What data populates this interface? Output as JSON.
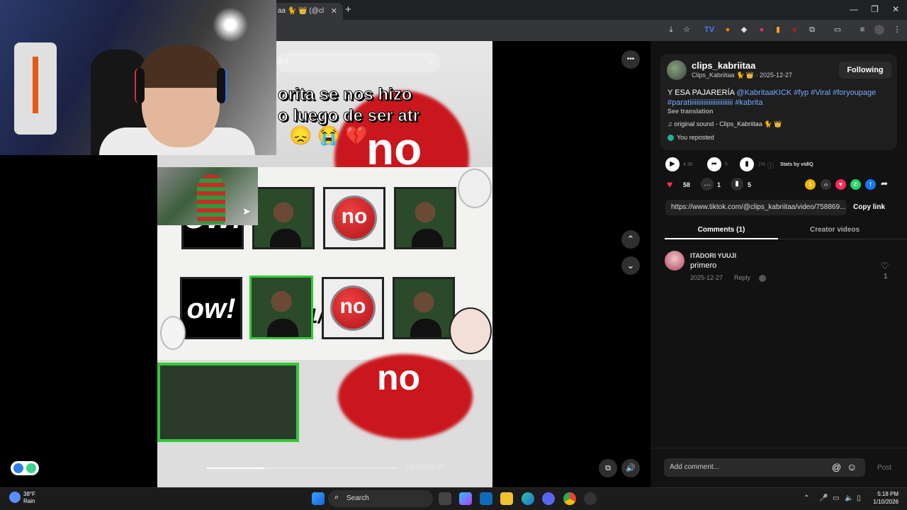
{
  "browser": {
    "tab_title": "aa 🐈 👑 (@cl",
    "tab_close": "✕",
    "new_tab": "+",
    "window_controls": [
      "—",
      "❐",
      "✕"
    ]
  },
  "video": {
    "overlay_line1": "orita se nos hizo",
    "overlay_line2": "o luego de ser atr",
    "overlay_emojis": "😞 😭 💔",
    "top_bg_text": "no",
    "grid_counter": "1/5",
    "row1": [
      "OW!",
      "face",
      "no",
      "face"
    ],
    "row2": [
      "ow!",
      "face",
      "no",
      "face"
    ],
    "bottom_bg_text": "no",
    "search_placeholder": "ent",
    "progress_fraction": 0.3,
    "time": "00:03/00:15"
  },
  "side_controls": {
    "more_icon": "•••",
    "up_icon": "⌃",
    "down_icon": "⌄"
  },
  "post": {
    "username": "clips_kabriitaa",
    "subline": "Clips_Kabriitaa 🐈 👑 · 2025-12-27",
    "follow_label": "Following",
    "desc_prefix": "Y ESA PAJARERÍA ",
    "desc_mention": "@KabritaaKICK",
    "desc_tags1": " #fyp #Viral #foryoupage",
    "desc_tags2": "#paratiiiiiiiiiiiiiiiiiiiiiiiii #kabrita",
    "see_translation": "See translation",
    "sound": "♫  original sound - Clips_Kabriitaa 🐈 👑",
    "reposted": "You reposted"
  },
  "stats": {
    "views": "4.3K",
    "shares_small": "5",
    "pct": "1%",
    "stats_by": "Stats by vidIQ",
    "likes": "58",
    "comments": "1",
    "saves": "5"
  },
  "share": {
    "url": "https://www.tiktok.com/@clips_kabriitaa/video/758869...",
    "copy_label": "Copy link"
  },
  "tabs": {
    "comments": "Comments (1)",
    "creator": "Creator videos"
  },
  "comment": {
    "user": "ITADORI YUUJI",
    "text": "primero",
    "date": "2025-12-27",
    "reply": "Reply",
    "likes": "1"
  },
  "compose": {
    "placeholder": "Add comment...",
    "at": "@",
    "emoji": "☺",
    "post": "Post"
  },
  "taskbar": {
    "weather_temp": "38°F",
    "weather_desc": "Rain",
    "search": "Search",
    "time": "5:18 PM",
    "date": "1/10/2026"
  },
  "colors": {
    "accent_blue": "#77a8ff",
    "like_red": "#fe2c55",
    "no_red": "#c9171d"
  }
}
